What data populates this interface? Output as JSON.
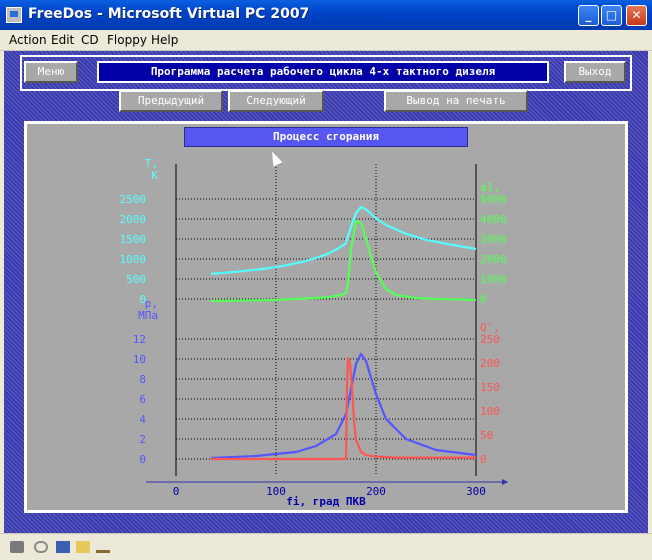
{
  "window": {
    "title": "FreeDos - Microsoft Virtual PC 2007"
  },
  "menu": [
    "Action",
    "Edit",
    "CD",
    "Floppy",
    "Help"
  ],
  "dos": {
    "menu_button": "Меню",
    "program_title": "Программа расчета рабочего цикла 4-х тактного дизеля",
    "exit_button": "Выход",
    "prev_button": "Предыдущий",
    "next_button": "Следующий",
    "print_button": "Вывод на печать",
    "chart_banner": "Процесс сгорания"
  },
  "colors": {
    "temperature": "#55ffff",
    "heat_release": "#55ff55",
    "pressure": "#5555ff",
    "heat_rate": "#ff5555"
  },
  "chart_data": [
    {
      "type": "line",
      "title": "Процесс сгорания",
      "xlabel": "fi, град ПКВ",
      "xlim": [
        0,
        300
      ],
      "x_ticks": [
        0,
        100,
        200,
        300
      ],
      "left_axis": {
        "label": [
          "T,",
          "K"
        ],
        "ticks": [
          0,
          500,
          1000,
          1500,
          2000,
          2500
        ],
        "ylim": [
          0,
          2500
        ]
      },
      "right_axis": {
        "label": [
          "a1,",
          "-"
        ],
        "ticks": [
          0,
          1000,
          2000,
          3000,
          4000,
          5000
        ],
        "ylim": [
          0,
          5000
        ]
      },
      "grid": true,
      "series": [
        {
          "axis": "left",
          "color": "#55ffff",
          "x": [
            35,
            60,
            90,
            110,
            130,
            150,
            160,
            170,
            171,
            175,
            180,
            185,
            190,
            200,
            210,
            230,
            250,
            270,
            300
          ],
          "y": [
            630,
            680,
            760,
            840,
            950,
            1110,
            1230,
            1390,
            1500,
            1800,
            2150,
            2300,
            2240,
            2020,
            1850,
            1630,
            1480,
            1380,
            1250
          ]
        },
        {
          "axis": "right",
          "color": "#55ff55",
          "x": [
            35,
            100,
            150,
            165,
            170,
            172,
            175,
            180,
            185,
            190,
            200,
            210,
            220,
            240,
            260,
            280,
            300
          ],
          "y": [
            -100,
            -50,
            80,
            200,
            300,
            800,
            2500,
            3900,
            3800,
            3000,
            1300,
            500,
            200,
            50,
            0,
            -20,
            -50
          ]
        }
      ]
    },
    {
      "type": "line",
      "xlabel": "fi, град ПКВ",
      "xlim": [
        0,
        300
      ],
      "x_ticks": [
        0,
        100,
        200,
        300
      ],
      "left_axis": {
        "label": [
          "p,",
          "МПа"
        ],
        "ticks": [
          0,
          2,
          4,
          6,
          8,
          10,
          12
        ],
        "ylim": [
          0,
          12
        ]
      },
      "right_axis": {
        "label": [
          "Q',",
          "-"
        ],
        "ticks": [
          0,
          50,
          100,
          150,
          200,
          250
        ],
        "ylim": [
          0,
          250
        ]
      },
      "grid": true,
      "series": [
        {
          "axis": "left",
          "color": "#5555ff",
          "x": [
            35,
            80,
            120,
            140,
            160,
            170,
            175,
            180,
            185,
            190,
            200,
            210,
            230,
            260,
            300
          ],
          "y": [
            0.1,
            0.3,
            0.7,
            1.3,
            2.5,
            4.5,
            7.0,
            9.5,
            10.5,
            9.8,
            6.5,
            4.0,
            2.0,
            0.9,
            0.4
          ]
        },
        {
          "axis": "right",
          "color": "#ff5555",
          "x": [
            35,
            100,
            160,
            168,
            170,
            171,
            172,
            174,
            176,
            178,
            180,
            185,
            190,
            200,
            220,
            260,
            300
          ],
          "y": [
            0,
            0,
            0,
            0,
            2,
            150,
            210,
            200,
            150,
            80,
            40,
            15,
            8,
            5,
            3,
            3,
            3
          ]
        }
      ]
    }
  ]
}
